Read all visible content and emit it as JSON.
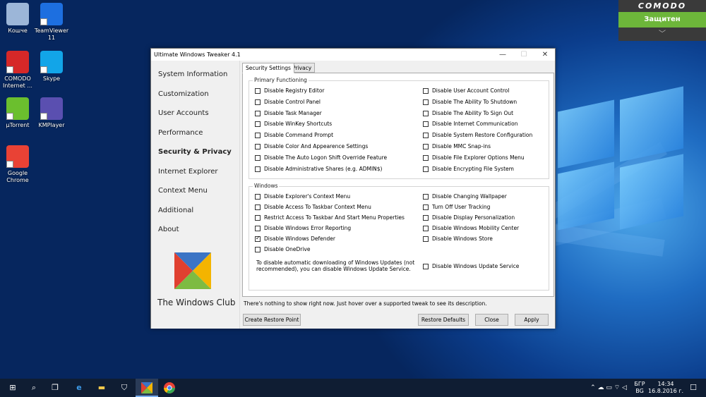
{
  "desktop": {
    "icons": [
      {
        "label": "Кошче",
        "icon": "recycle-bin-icon",
        "color": "#9cb6d8"
      },
      {
        "label": "TeamViewer 11",
        "icon": "teamviewer-icon",
        "color": "#1d6fe0"
      },
      {
        "label": "COMODO Internet ...",
        "icon": "comodo-icon",
        "color": "#d62828"
      },
      {
        "label": "Skype",
        "icon": "skype-icon",
        "color": "#12a5e8"
      },
      {
        "label": "µTorrent",
        "icon": "utorrent-icon",
        "color": "#6bbf2e"
      },
      {
        "label": "KMPlayer",
        "icon": "kmplayer-icon",
        "color": "#5a4fb0"
      },
      {
        "label": "Google Chrome",
        "icon": "chrome-icon",
        "color": "#e94235"
      }
    ]
  },
  "comodo": {
    "brand": "COMODO",
    "status": "Защитен",
    "chevron": "﹀"
  },
  "window": {
    "title": "Ultimate Windows Tweaker 4.1",
    "minimize": "—",
    "maximize": "☐",
    "close": "✕"
  },
  "sidebar": {
    "items": [
      "System Information",
      "Customization",
      "User Accounts",
      "Performance",
      "Security & Privacy",
      "Internet Explorer",
      "Context Menu",
      "Additional",
      "About"
    ],
    "active_index": 4,
    "logo_text": "The Windows Club"
  },
  "tabs": [
    "Security Settings",
    "Privacy"
  ],
  "primary": {
    "legend": "Primary Functioning",
    "left": [
      {
        "label": "Disable Registry Editor",
        "checked": false
      },
      {
        "label": "Disable Control Panel",
        "checked": false
      },
      {
        "label": "Disable Task Manager",
        "checked": false
      },
      {
        "label": "Disable WinKey Shortcuts",
        "checked": false
      },
      {
        "label": "Disable Command Prompt",
        "checked": false
      },
      {
        "label": "Disable Color And Appearence Settings",
        "checked": false
      },
      {
        "label": "Disable The Auto Logon Shift Override Feature",
        "checked": false
      },
      {
        "label": "Disable Administrative Shares (e.g. ADMIN$)",
        "checked": false
      }
    ],
    "right": [
      {
        "label": "Disable User Account Control",
        "checked": false
      },
      {
        "label": "Disable The Ability To Shutdown",
        "checked": false
      },
      {
        "label": "Disable The Ability To Sign Out",
        "checked": false
      },
      {
        "label": "Disable Internet Communication",
        "checked": false
      },
      {
        "label": "Disable System Restore Configuration",
        "checked": false
      },
      {
        "label": "Disable MMC Snap-ins",
        "checked": false
      },
      {
        "label": "Disable File Explorer Options Menu",
        "checked": false
      },
      {
        "label": "Disable Encrypting File System",
        "checked": false
      }
    ]
  },
  "windows": {
    "legend": "Windows",
    "left": [
      {
        "label": "Disable Explorer's Context Menu",
        "checked": false
      },
      {
        "label": "Disable Access To Taskbar Context Menu",
        "checked": false
      },
      {
        "label": "Restrict Access To Taskbar And Start Menu Properties",
        "checked": false
      },
      {
        "label": "Disable Windows Error Reporting",
        "checked": false
      },
      {
        "label": "Disable Windows Defender",
        "checked": true
      },
      {
        "label": "Disable OneDrive",
        "checked": false
      }
    ],
    "right": [
      {
        "label": "Disable Changing Wallpaper",
        "checked": false
      },
      {
        "label": "Turn Off User Tracking",
        "checked": false
      },
      {
        "label": "Disable Display Personalization",
        "checked": false
      },
      {
        "label": "Disable Windows Mobility Center",
        "checked": false
      },
      {
        "label": "Disable Windows Store",
        "checked": false
      }
    ],
    "note_line1": "To disable automatic downloading of Windows Updates (not",
    "note_line2": "recommended), you can disable Windows Update Service.",
    "update_service": {
      "label": "Disable Windows Update Service",
      "checked": false
    }
  },
  "status_text": "There's nothing to show right now. Just hover over a supported tweak to see its description.",
  "buttons": {
    "restore_point": "Create Restore Point",
    "restore_defaults": "Restore Defaults",
    "close": "Close",
    "apply": "Apply"
  },
  "taskbar": {
    "start": "⊞",
    "search": "⌕",
    "task_view": "❐",
    "edge": "e",
    "explorer": "▬",
    "store": "⛉",
    "tray_icons": "⌃ ☁ ▭ ⌔ ◁",
    "lang_top": "БГР",
    "lang_bottom": "BG",
    "time": "14:34",
    "date": "16.8.2016 г.",
    "notifications": "☐"
  }
}
